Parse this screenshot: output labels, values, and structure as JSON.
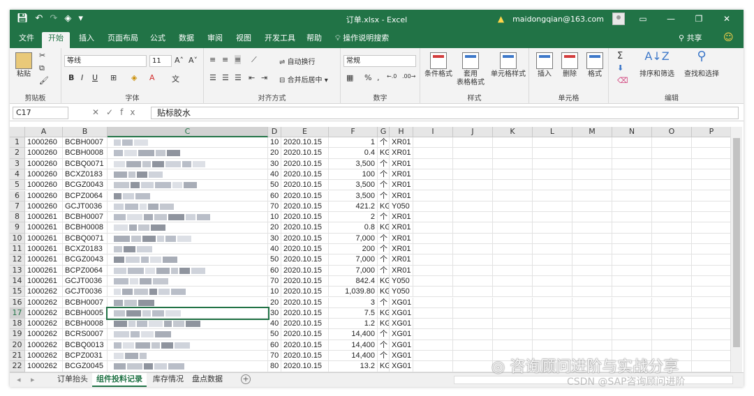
{
  "window": {
    "title": "订单.xlsx - Excel",
    "account": "maidongqian@163.com",
    "share": "共享"
  },
  "tabs": [
    "文件",
    "开始",
    "插入",
    "页面布局",
    "公式",
    "数据",
    "审阅",
    "视图",
    "开发工具",
    "帮助"
  ],
  "tell_me": "操作说明搜索",
  "ribbon": {
    "clipboard": {
      "label": "剪贴板",
      "paste": "粘贴"
    },
    "font": {
      "label": "字体",
      "font_name": "等线",
      "font_size": "11",
      "bold": "B",
      "italic": "I",
      "underline": "U"
    },
    "alignment": {
      "label": "对齐方式",
      "wrap": "自动换行",
      "merge": "合并后居中"
    },
    "number": {
      "label": "数字",
      "format": "常规"
    },
    "styles": {
      "label": "样式",
      "conditional": "条件格式",
      "table_line1": "套用",
      "table_line2": "表格格式",
      "cell_styles": "单元格样式"
    },
    "cells": {
      "label": "单元格",
      "insert": "插入",
      "delete": "删除",
      "format": "格式"
    },
    "editing": {
      "label": "编辑",
      "sort": "排序和筛选",
      "find": "查找和选择"
    }
  },
  "formula_bar": {
    "name_box": "C17",
    "content": "贴标胶水"
  },
  "columns": [
    "A",
    "B",
    "C",
    "D",
    "E",
    "F",
    "G",
    "H",
    "I",
    "J",
    "K",
    "L",
    "M",
    "N",
    "O",
    "P"
  ],
  "rows": [
    {
      "n": "1",
      "a": "1000260",
      "b": "BCBH0007",
      "d": "10",
      "e": "2020.10.15",
      "f": "1",
      "g": "个",
      "h": "XR01"
    },
    {
      "n": "2",
      "a": "1000260",
      "b": "BCBH0008",
      "d": "20",
      "e": "2020.10.15",
      "f": "0.4",
      "g": "KG",
      "h": "XR01"
    },
    {
      "n": "3",
      "a": "1000260",
      "b": "BCBQ0071",
      "d": "30",
      "e": "2020.10.15",
      "f": "3,500",
      "g": "个",
      "h": "XR01"
    },
    {
      "n": "4",
      "a": "1000260",
      "b": "BCXZ0183",
      "d": "40",
      "e": "2020.10.15",
      "f": "100",
      "g": "个",
      "h": "XR01"
    },
    {
      "n": "5",
      "a": "1000260",
      "b": "BCGZ0043",
      "d": "50",
      "e": "2020.10.15",
      "f": "3,500",
      "g": "个",
      "h": "XR01"
    },
    {
      "n": "6",
      "a": "1000260",
      "b": "BCPZ0064",
      "d": "60",
      "e": "2020.10.15",
      "f": "3,500",
      "g": "个",
      "h": "XR01"
    },
    {
      "n": "7",
      "a": "1000260",
      "b": "GCJT0036",
      "d": "70",
      "e": "2020.10.15",
      "f": "421.2",
      "g": "KG",
      "h": "Y050"
    },
    {
      "n": "8",
      "a": "1000261",
      "b": "BCBH0007",
      "d": "10",
      "e": "2020.10.15",
      "f": "2",
      "g": "个",
      "h": "XR01"
    },
    {
      "n": "9",
      "a": "1000261",
      "b": "BCBH0008",
      "d": "20",
      "e": "2020.10.15",
      "f": "0.8",
      "g": "KG",
      "h": "XR01"
    },
    {
      "n": "10",
      "a": "1000261",
      "b": "BCBQ0071",
      "d": "30",
      "e": "2020.10.15",
      "f": "7,000",
      "g": "个",
      "h": "XR01"
    },
    {
      "n": "11",
      "a": "1000261",
      "b": "BCXZ0183",
      "d": "40",
      "e": "2020.10.15",
      "f": "200",
      "g": "个",
      "h": "XR01"
    },
    {
      "n": "12",
      "a": "1000261",
      "b": "BCGZ0043",
      "d": "50",
      "e": "2020.10.15",
      "f": "7,000",
      "g": "个",
      "h": "XR01"
    },
    {
      "n": "13",
      "a": "1000261",
      "b": "BCPZ0064",
      "d": "60",
      "e": "2020.10.15",
      "f": "7,000",
      "g": "个",
      "h": "XR01"
    },
    {
      "n": "14",
      "a": "1000261",
      "b": "GCJT0036",
      "d": "70",
      "e": "2020.10.15",
      "f": "842.4",
      "g": "KG",
      "h": "Y050"
    },
    {
      "n": "15",
      "a": "1000262",
      "b": "GCJT0036",
      "d": "10",
      "e": "2020.10.15",
      "f": "1,039.80",
      "g": "KG",
      "h": "Y050"
    },
    {
      "n": "16",
      "a": "1000262",
      "b": "BCBH0007",
      "d": "20",
      "e": "2020.10.15",
      "f": "3",
      "g": "个",
      "h": "XG01"
    },
    {
      "n": "17",
      "a": "1000262",
      "b": "BCBH0005",
      "d": "30",
      "e": "2020.10.15",
      "f": "7.5",
      "g": "KG",
      "h": "XG01"
    },
    {
      "n": "18",
      "a": "1000262",
      "b": "BCBH0008",
      "d": "40",
      "e": "2020.10.15",
      "f": "1.2",
      "g": "KG",
      "h": "XG01"
    },
    {
      "n": "19",
      "a": "1000262",
      "b": "BCRS0007",
      "d": "50",
      "e": "2020.10.15",
      "f": "14,400",
      "g": "个",
      "h": "XG01"
    },
    {
      "n": "20",
      "a": "1000262",
      "b": "BCBQ0013",
      "d": "60",
      "e": "2020.10.15",
      "f": "14,400",
      "g": "个",
      "h": "XG01"
    },
    {
      "n": "21",
      "a": "1000262",
      "b": "BCPZ0031",
      "d": "70",
      "e": "2020.10.15",
      "f": "14,400",
      "g": "个",
      "h": "XG01"
    },
    {
      "n": "22",
      "a": "1000262",
      "b": "BCGZ0045",
      "d": "80",
      "e": "2020.10.15",
      "f": "13.2",
      "g": "KG",
      "h": "XG01"
    }
  ],
  "sheets": [
    "订单抬头",
    "组件投料记录",
    "库存情况",
    "盘点数据"
  ],
  "active_sheet_index": 1,
  "active_cell": {
    "row": 17,
    "col": "C"
  },
  "watermark": "咨询顾问进阶与实战分享",
  "csdn": "CSDN @SAP咨询顾问进阶",
  "colors": {
    "accent": "#217346",
    "ribbon_bg": "#f3f3f3"
  }
}
